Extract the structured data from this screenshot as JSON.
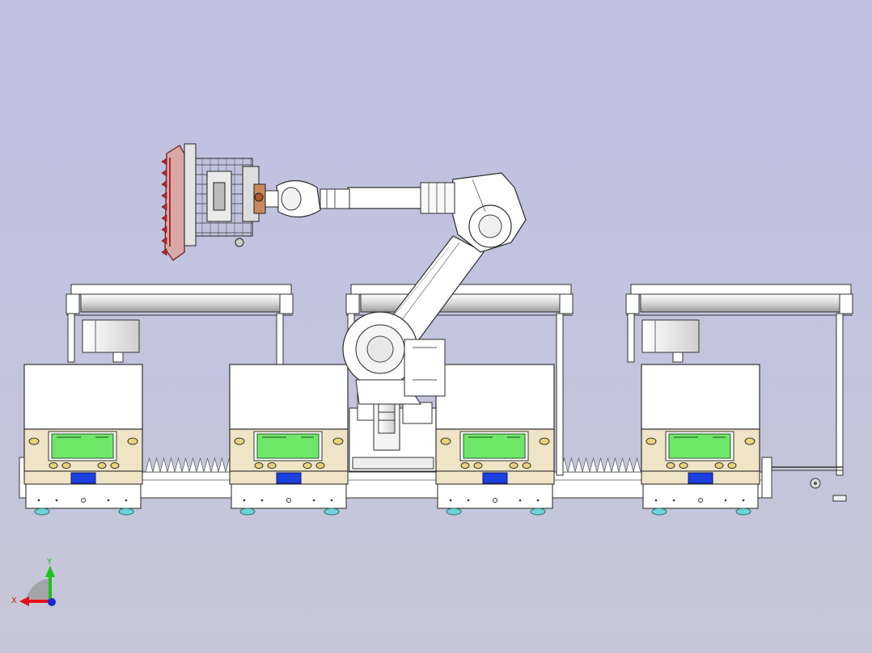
{
  "view": {
    "background_top": "#bfc0e0",
    "background_bottom": "#c6c7d6"
  },
  "triad": {
    "x_label": "X",
    "y_label": "Y",
    "x_color": "#e0101a",
    "y_color": "#18c418",
    "z_color": "#1a2ad0"
  },
  "stations": {
    "count": 4,
    "screen_color": "#6fe86a",
    "panel_color": "#efe4c6",
    "badge_color": "#1b3fe0",
    "wheel_color": "#6fd4da"
  },
  "robot": {
    "body_color": "#ffffff",
    "outline_color": "#2a2a2a",
    "gripper_accent": "#b4282a"
  }
}
